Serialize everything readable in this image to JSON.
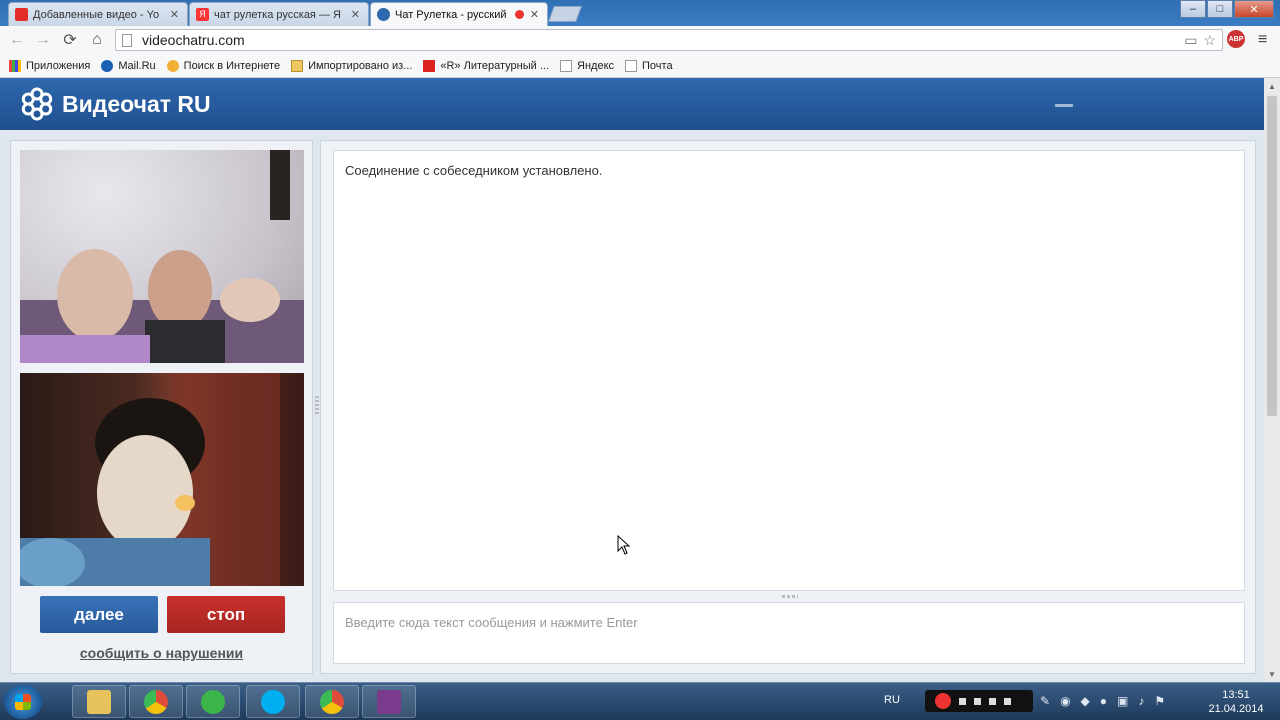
{
  "browser": {
    "tabs": [
      {
        "label": "Добавленные видео - Yo",
        "icon": "youtube-icon",
        "active": false
      },
      {
        "label": "чат рулетка русская — Я",
        "icon": "yandex-icon",
        "active": false
      },
      {
        "label": "Чат Рулетка - русский",
        "icon": "videochat-icon",
        "active": true
      }
    ],
    "address": "videochatru.com",
    "window_controls": {
      "minimize": "–",
      "maximize": "□",
      "close": "✕"
    },
    "bookmarks": [
      {
        "label": "Приложения",
        "icon": "apps-icon"
      },
      {
        "label": "Mail.Ru",
        "icon": "mailru-icon"
      },
      {
        "label": "Поиск в Интернете",
        "icon": "search-icon"
      },
      {
        "label": "Импортировано из...",
        "icon": "folder-icon"
      },
      {
        "label": "«R» Литературный ...",
        "icon": "r-icon"
      },
      {
        "label": "Яндекс",
        "icon": "page-icon"
      },
      {
        "label": "Почта",
        "icon": "page-icon"
      }
    ]
  },
  "site": {
    "title": "Видеочат RU",
    "brand_color": "#2e68ad"
  },
  "video_panel": {
    "next_label": "далее",
    "stop_label": "стоп",
    "report_label": "сообщить о нарушении",
    "next_color": "#2f66ab",
    "stop_color": "#b92b27"
  },
  "chat": {
    "messages": [
      "Соединение с собеседником установлено."
    ],
    "input_placeholder": "Введите сюда текст сообщения и нажмите Enter"
  },
  "taskbar": {
    "apps": [
      {
        "name": "explorer-icon",
        "color": "#e8c25a"
      },
      {
        "name": "chrome-icon",
        "color": "#dd4b39"
      },
      {
        "name": "mail-agent-icon",
        "color": "#3bb54a"
      },
      {
        "name": "skype-icon",
        "color": "#00aff0"
      },
      {
        "name": "chrome-icon",
        "color": "#dd4b39"
      },
      {
        "name": "winrar-icon",
        "color": "#7a3b8c"
      }
    ],
    "language": "RU",
    "time": "13:51",
    "date": "21.04.2014"
  }
}
